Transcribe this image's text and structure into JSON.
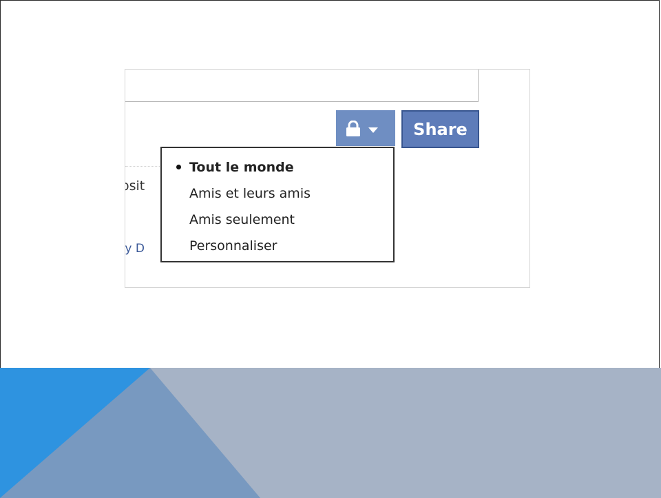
{
  "composer": {
    "status_value": "",
    "share_label": "Share",
    "privacy_icon": "lock-icon",
    "dropdown_icon": "caret-down-icon",
    "clipped_text_1": "osit",
    "clipped_text_2": "ity D"
  },
  "privacy_menu": {
    "items": [
      {
        "label": "Tout le monde",
        "selected": true
      },
      {
        "label": "Amis et leurs amis",
        "selected": false
      },
      {
        "label": "Amis seulement",
        "selected": false
      },
      {
        "label": "Personnaliser",
        "selected": false
      }
    ]
  },
  "colors": {
    "brand_blue": "#6f8ec2",
    "share_blue": "#5e7cb9",
    "band_light": "#a6b3c6",
    "band_mid": "#7899c0",
    "band_accent": "#2e93e0"
  }
}
